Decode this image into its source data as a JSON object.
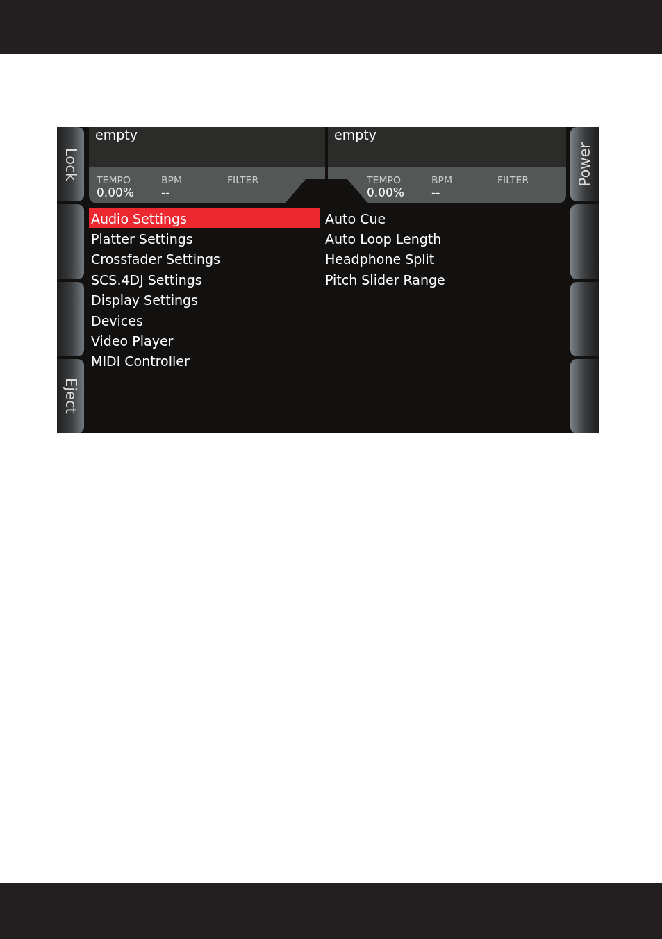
{
  "left_buttons": [
    {
      "kind": "labeled",
      "label": "Lock"
    },
    {
      "kind": "blank"
    },
    {
      "kind": "blank"
    },
    {
      "kind": "labeled",
      "label": "Eject"
    }
  ],
  "right_buttons": [
    {
      "kind": "labeled",
      "label": "Power"
    },
    {
      "kind": "blank"
    },
    {
      "kind": "blank"
    },
    {
      "kind": "blank"
    }
  ],
  "decks": [
    {
      "title": "empty",
      "stats": [
        {
          "label": "TEMPO",
          "value": "0.00%"
        },
        {
          "label": "BPM",
          "value": "--"
        },
        {
          "label": "FILTER"
        }
      ]
    },
    {
      "title": "empty",
      "stats": [
        {
          "label": "TEMPO",
          "value": "0.00%"
        },
        {
          "label": "BPM",
          "value": "--"
        },
        {
          "label": "FILTER"
        }
      ]
    }
  ],
  "menu": {
    "categories": [
      {
        "label": "Audio Settings",
        "selected": true
      },
      {
        "label": "Platter Settings",
        "selected": false
      },
      {
        "label": "Crossfader Settings",
        "selected": false
      },
      {
        "label": "SCS.4DJ Settings",
        "selected": false
      },
      {
        "label": "Display Settings",
        "selected": false
      },
      {
        "label": "Devices",
        "selected": false
      },
      {
        "label": "Video Player",
        "selected": false
      },
      {
        "label": "MIDI Controller",
        "selected": false
      }
    ],
    "options": [
      {
        "label": "Auto Cue",
        "selected": false
      },
      {
        "label": "Auto Loop Length",
        "selected": false
      },
      {
        "label": "Headphone Split",
        "selected": false
      },
      {
        "label": "Pitch Slider Range",
        "selected": false
      }
    ]
  }
}
